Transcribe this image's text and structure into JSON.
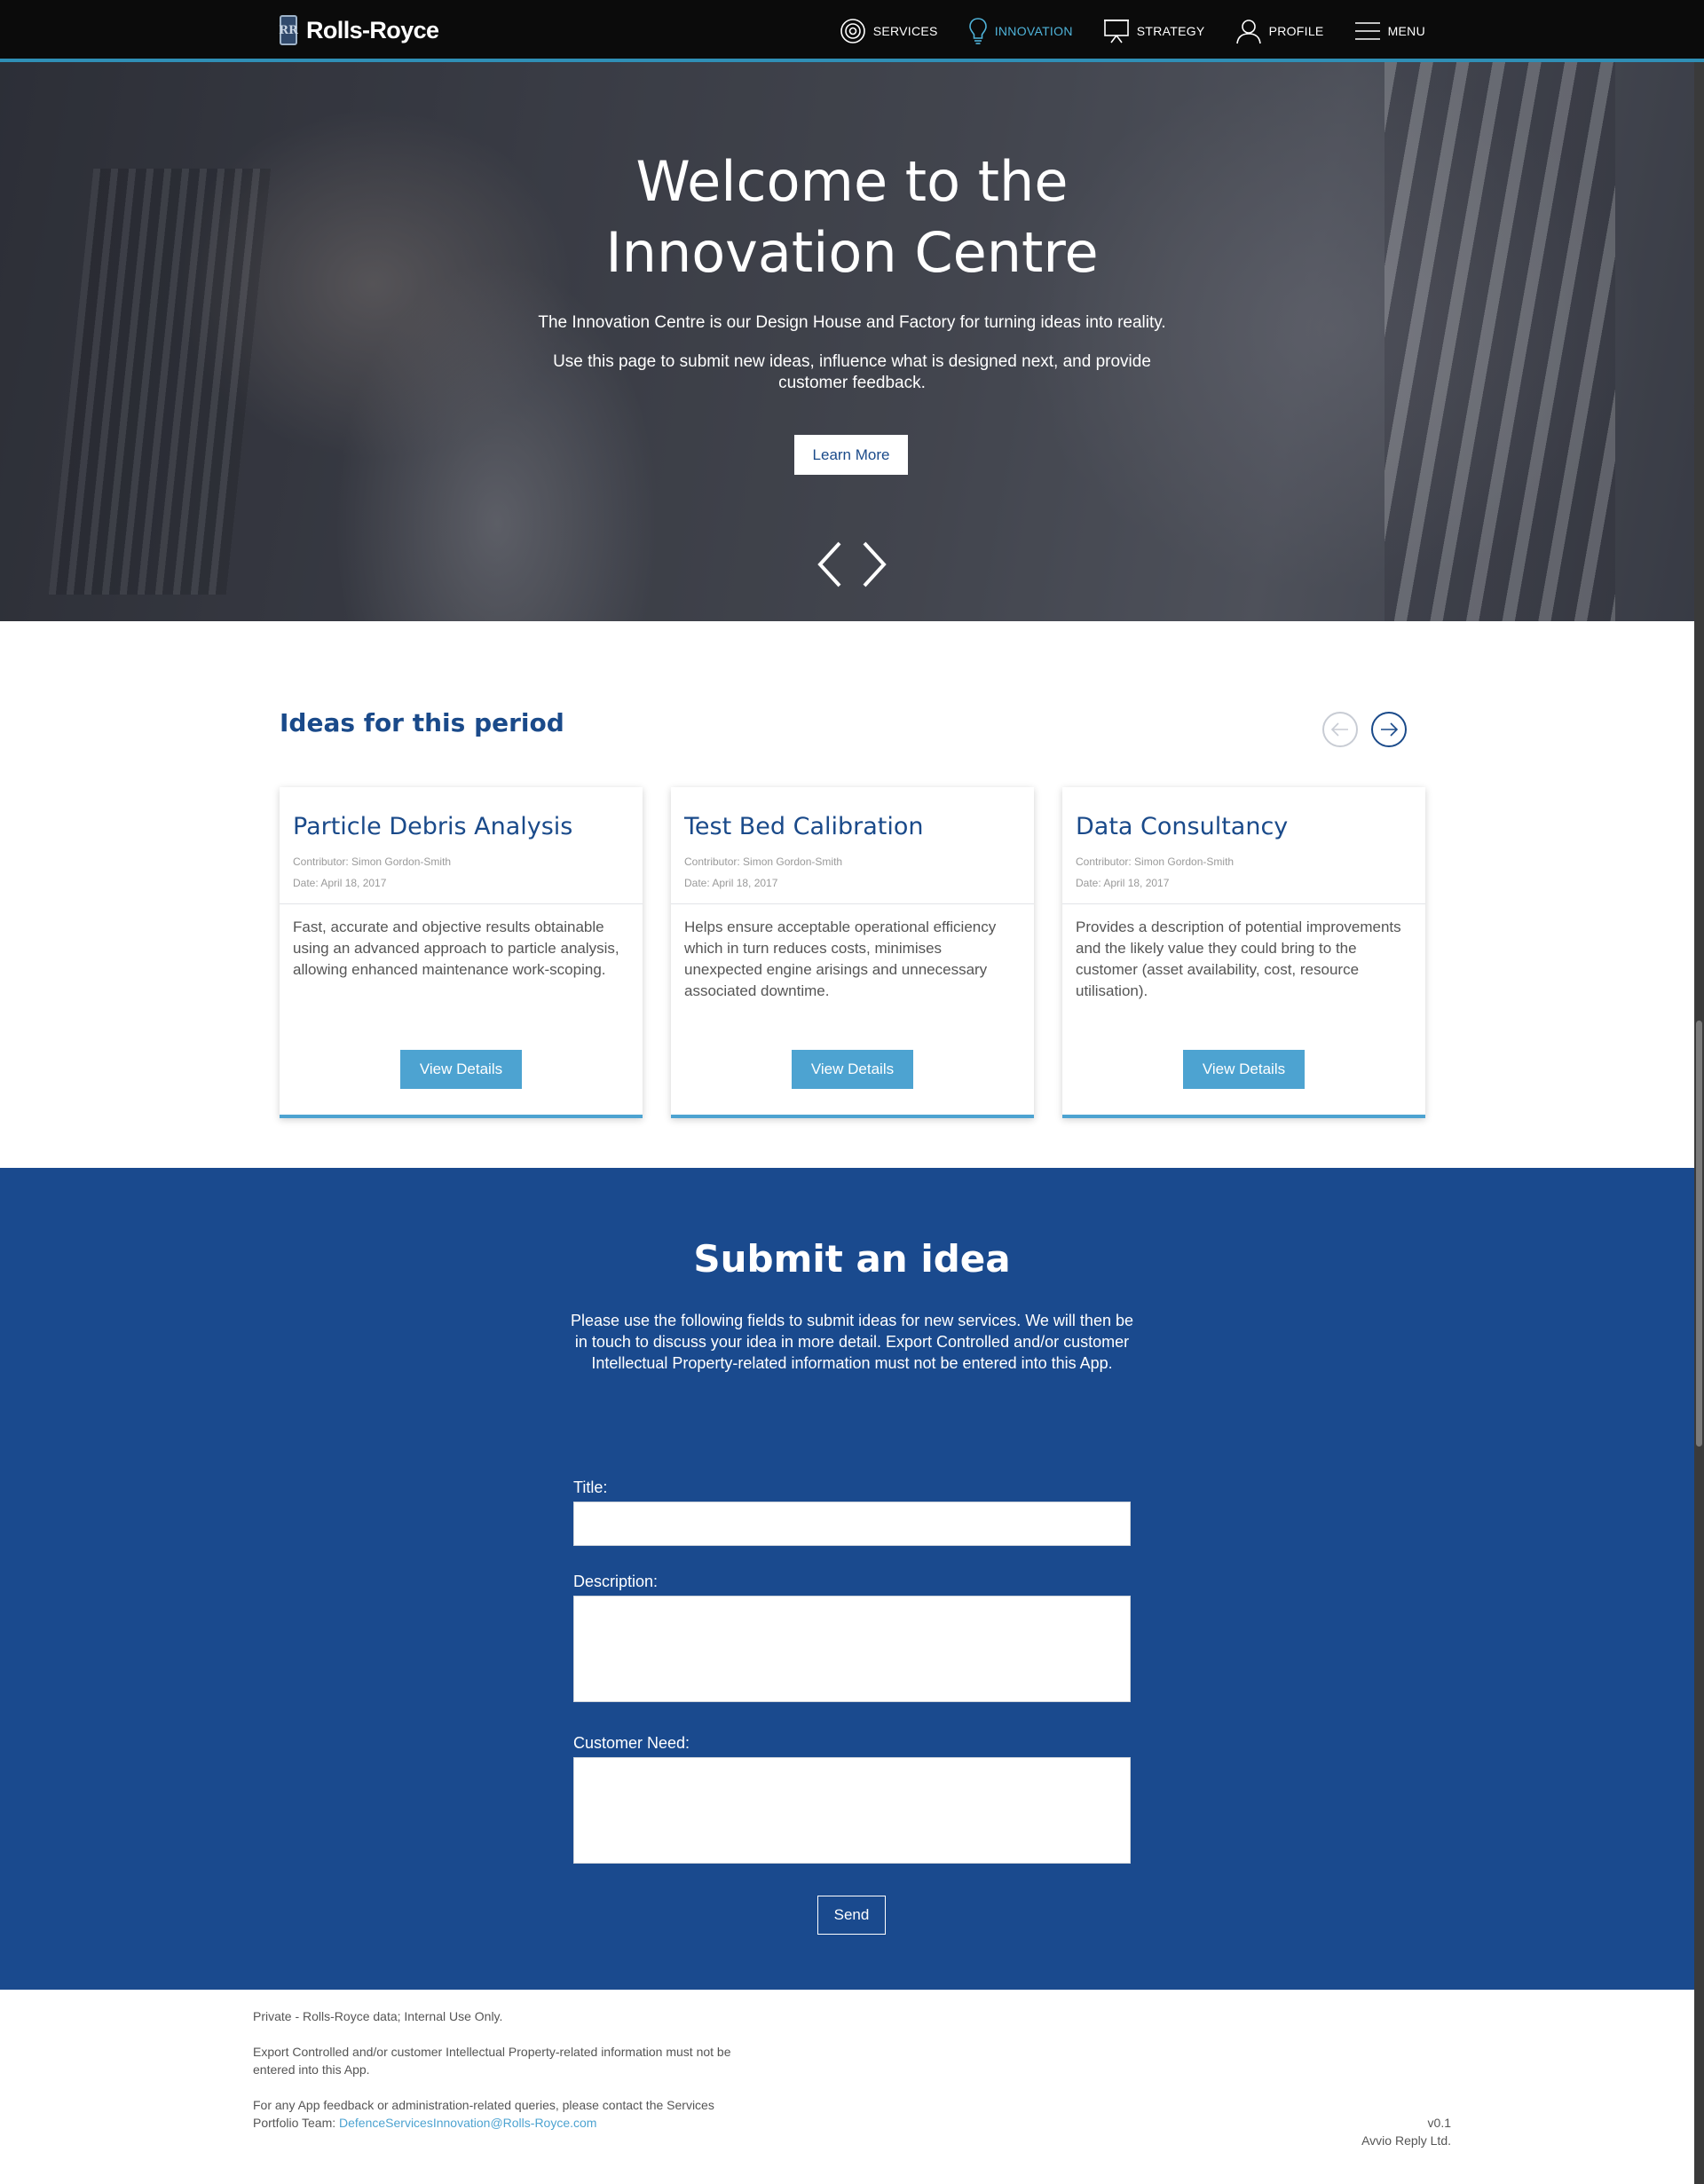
{
  "brand": {
    "name": "Rolls-Royce",
    "badge": "RR"
  },
  "nav": {
    "items": [
      {
        "label": "SERVICES",
        "icon": "target-icon",
        "active": false
      },
      {
        "label": "INNOVATION",
        "icon": "lightbulb-icon",
        "active": true
      },
      {
        "label": "STRATEGY",
        "icon": "presentation-icon",
        "active": false
      },
      {
        "label": "PROFILE",
        "icon": "user-icon",
        "active": false
      },
      {
        "label": "MENU",
        "icon": "hamburger-icon",
        "active": false
      }
    ]
  },
  "hero": {
    "title": "Welcome to the Innovation Centre",
    "paragraph1": "The Innovation Centre is our Design House and Factory for turning ideas into reality.",
    "paragraph2": "Use this page to submit new ideas, influence what is designed next, and provide customer feedback.",
    "button": "Learn More"
  },
  "ideas": {
    "title": "Ideas for this period",
    "cards": [
      {
        "title": "Particle Debris Analysis",
        "contributor": "Contributor: Simon Gordon-Smith",
        "date": "Date: April 18, 2017",
        "description": "Fast, accurate and objective results obtainable using an advanced approach to particle analysis, allowing enhanced maintenance work-scoping.",
        "button": "View Details"
      },
      {
        "title": "Test Bed Calibration",
        "contributor": "Contributor: Simon Gordon-Smith",
        "date": "Date: April 18, 2017",
        "description": "Helps ensure acceptable operational efficiency which in turn reduces costs, minimises unexpected engine arisings and unnecessary associated downtime.",
        "button": "View Details"
      },
      {
        "title": "Data Consultancy",
        "contributor": "Contributor: Simon Gordon-Smith",
        "date": "Date: April 18, 2017",
        "description": "Provides a description of potential improvements and the likely value they could bring to the customer (asset availability, cost, resource utilisation).",
        "button": "View Details"
      }
    ]
  },
  "submit": {
    "title": "Submit an idea",
    "description": "Please use the following fields to submit ideas for new services. We will then be in touch to discuss your idea in more detail. Export Controlled and/or customer Intellectual Property-related information must not be entered into this App.",
    "fields": {
      "title_label": "Title:",
      "title_value": "",
      "description_label": "Description:",
      "description_value": "",
      "need_label": "Customer Need:",
      "need_value": ""
    },
    "send": "Send"
  },
  "footer": {
    "line1": "Private - Rolls-Royce data; Internal Use Only.",
    "line2": "Export Controlled and/or customer Intellectual Property-related information must not be entered into this App.",
    "line3": "For any App feedback or administration-related queries, please contact the Services Portfolio Team:",
    "email": "DefenceServicesInnovation@Rolls-Royce.com",
    "version": "v0.1",
    "company": "Avvio Reply Ltd."
  },
  "colors": {
    "accent": "#4da3d1",
    "brand_blue": "#1a4a8e",
    "nav_bg": "#0b0b0b"
  }
}
